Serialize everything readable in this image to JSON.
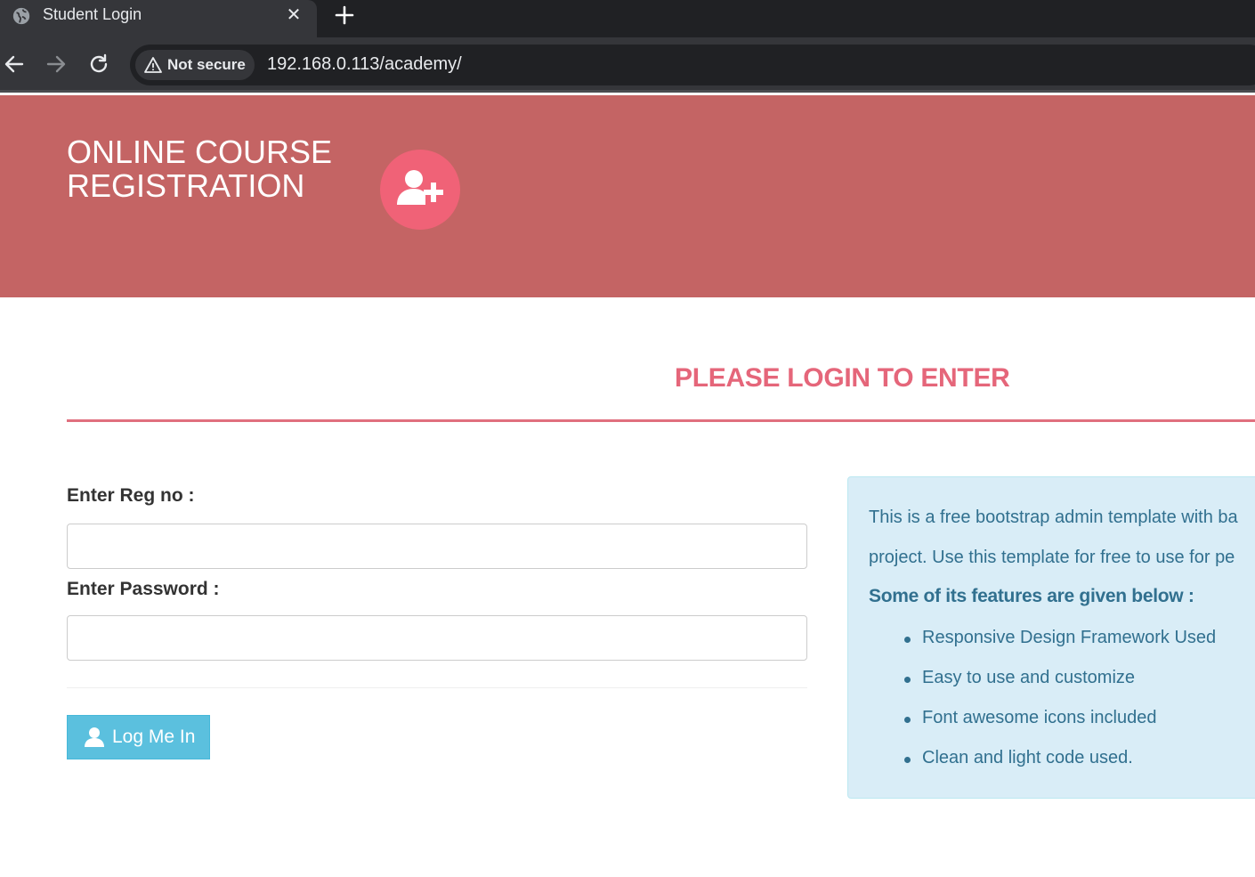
{
  "browser": {
    "tab_title": "Student Login",
    "tab_close": "✕",
    "security_label": "Not secure",
    "url": "192.168.0.113/academy/"
  },
  "header": {
    "site_title": "ONLINE COURSE REGISTRATION",
    "badge_icon": "user-plus-icon",
    "background_color": "#c46464",
    "badge_color": "#f06277"
  },
  "main": {
    "heading": "PLEASE LOGIN TO ENTER",
    "heading_color": "#e5667a",
    "form": {
      "regno_label": "Enter Reg no :",
      "regno_value": "",
      "password_label": "Enter Password :",
      "password_value": "",
      "submit_label": "Log Me In",
      "submit_icon": "user-icon",
      "submit_color": "#5bc0de"
    },
    "info": {
      "line1": "This is a free bootstrap admin template with ba",
      "line2": "project. Use this template for free to use for pe",
      "features_heading": "Some of its features are given below :",
      "features": [
        "Responsive Design Framework Used",
        "Easy to use and customize",
        "Font awesome icons included",
        "Clean and light code used."
      ],
      "background_color": "#d9edf7",
      "text_color": "#31708f"
    }
  }
}
